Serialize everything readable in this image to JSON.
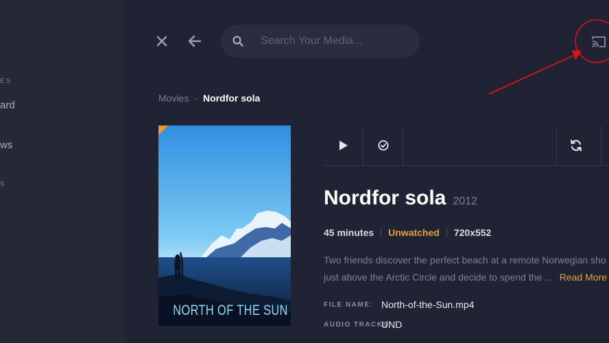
{
  "sidebar": {
    "sections": [
      {
        "label": "ES"
      },
      {
        "label": "S"
      }
    ],
    "items": [
      {
        "label": "ard"
      },
      {
        "label": "ws"
      }
    ]
  },
  "header": {
    "search_placeholder": "Search Your Media..."
  },
  "breadcrumb": {
    "parent": "Movies",
    "separator": "-",
    "current": "Nordfor sola"
  },
  "poster": {
    "title_text": "NORTH OF THE SUN"
  },
  "movie": {
    "title": "Nordfor sola",
    "year": "2012",
    "duration": "45 minutes",
    "status": "Unwatched",
    "resolution": "720x552",
    "description_line1": "Two friends discover the perfect beach at a remote Norwegian sho",
    "description_line2": "just above the Arctic Circle and decide to spend the ...",
    "read_more": "Read More",
    "file_name_label": "FILE NAME:",
    "file_name": "North-of-the-Sun.mp4",
    "audio_tracks_label": "AUDIO TRACKS:",
    "audio_tracks": "UND"
  },
  "colors": {
    "accent": "#e5a13a",
    "background": "#202334",
    "sidebar": "#252837",
    "annotation": "#e0101a"
  },
  "icons": {
    "close": "close-icon",
    "back": "arrow-left-icon",
    "search": "search-icon",
    "cast": "cast-icon",
    "play": "play-icon",
    "mark_watched": "check-circle-icon",
    "refresh": "refresh-icon"
  }
}
